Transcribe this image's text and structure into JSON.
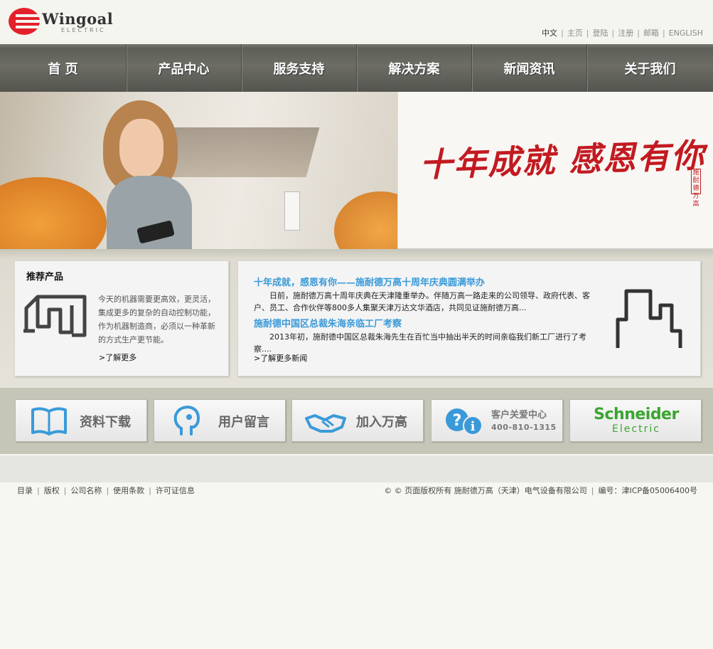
{
  "header": {
    "logo_text": "Wingoal",
    "logo_sub": "ELECTRIC",
    "links": [
      "中文",
      "主页",
      "登陆",
      "注册",
      "邮箱",
      "ENGLISH"
    ]
  },
  "nav": {
    "items": [
      "首 页",
      "产品中心",
      "服务支持",
      "解决方案",
      "新闻资讯",
      "关于我们"
    ]
  },
  "banner": {
    "slogan": "十年成就 感恩有你",
    "seal": "施耐德万高"
  },
  "products": {
    "title": "推荐产品",
    "desc": "今天的机器需要更高效，更灵活，集成更多的复杂的自动控制功能，作为机器制造商，必须以一种革新的方式生产更节能。",
    "more": ">了解更多"
  },
  "news": {
    "items": [
      {
        "title": "十年成就，感恩有你——施耐德万高十周年庆典圆满举办",
        "desc": "日前，施耐德万高十周年庆典在天津隆重举办。伴随万高一路走来的公司领导、政府代表、客户、员工、合作伙伴等800多人集聚天津万达文华酒店，共同见证施耐德万高..."
      },
      {
        "title": "施耐德中国区总裁朱海亲临工厂考察",
        "desc": "2013年初，施耐德中国区总裁朱海先生在百忙当中抽出半天的时间亲临我们新工厂进行了考察...."
      }
    ],
    "more": ">了解更多新闻"
  },
  "tiles": {
    "download": "资料下载",
    "message": "用户留言",
    "join": "加入万高",
    "service": "客户关爱中心",
    "phone": "400-810-1315",
    "schneider_name": "Schneider",
    "schneider_sub": "Electric"
  },
  "footer": {
    "links": [
      "目录",
      "版权",
      "公司名称",
      "使用条款",
      "许可证信息"
    ],
    "copyright": "© © 页面版权所有 施耐德万高（天津）电气设备有限公司",
    "icp": "编号：津ICP备05006400号"
  },
  "colors": {
    "brand_red": "#e2212b",
    "news_blue": "#3a9ad9",
    "schneider_green": "#3aa530"
  }
}
